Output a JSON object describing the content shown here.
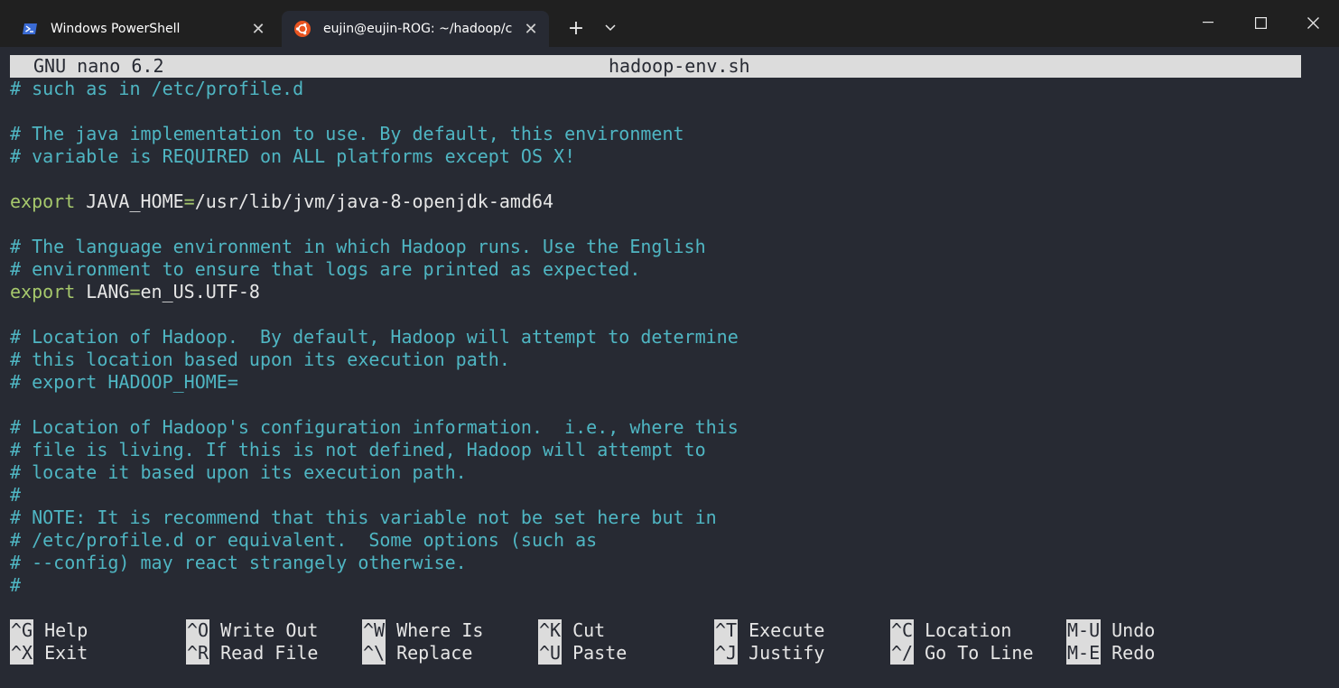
{
  "tabs": [
    {
      "label": "Windows PowerShell",
      "icon": "powershell-icon"
    },
    {
      "label": "eujin@eujin-ROG: ~/hadoop/c",
      "icon": "ubuntu-icon"
    }
  ],
  "colors": {
    "comment": "#4fb6c3",
    "keyword": "#a6c86c",
    "text": "#e6e6e6",
    "background": "#272a33",
    "header": "#dcdcdc"
  },
  "editor": {
    "name": "GNU nano 6.2",
    "filename": "hadoop-env.sh",
    "lines": [
      {
        "segments": [
          {
            "type": "comment",
            "text": "# such as in /etc/profile.d"
          }
        ]
      },
      {
        "segments": []
      },
      {
        "segments": [
          {
            "type": "comment",
            "text": "# The java implementation to use. By default, this environment"
          }
        ]
      },
      {
        "segments": [
          {
            "type": "comment",
            "text": "# variable is REQUIRED on ALL platforms except OS X!"
          }
        ]
      },
      {
        "segments": []
      },
      {
        "segments": [
          {
            "type": "kw",
            "text": "export"
          },
          {
            "type": "text",
            "text": " JAVA_HOME"
          },
          {
            "type": "op",
            "text": "="
          },
          {
            "type": "text",
            "text": "/usr/lib/jvm/java-8-openjdk-amd64"
          }
        ]
      },
      {
        "segments": []
      },
      {
        "segments": [
          {
            "type": "comment",
            "text": "# The language environment in which Hadoop runs. Use the English"
          }
        ]
      },
      {
        "segments": [
          {
            "type": "comment",
            "text": "# environment to ensure that logs are printed as expected."
          }
        ]
      },
      {
        "segments": [
          {
            "type": "kw",
            "text": "export"
          },
          {
            "type": "text",
            "text": " LANG"
          },
          {
            "type": "op",
            "text": "="
          },
          {
            "type": "text",
            "text": "en_US.UTF-8"
          }
        ]
      },
      {
        "segments": []
      },
      {
        "segments": [
          {
            "type": "comment",
            "text": "# Location of Hadoop.  By default, Hadoop will attempt to determine"
          }
        ]
      },
      {
        "segments": [
          {
            "type": "comment",
            "text": "# this location based upon its execution path."
          }
        ]
      },
      {
        "segments": [
          {
            "type": "comment",
            "text": "# export HADOOP_HOME="
          }
        ]
      },
      {
        "segments": []
      },
      {
        "segments": [
          {
            "type": "comment",
            "text": "# Location of Hadoop's configuration information.  i.e., where this"
          }
        ]
      },
      {
        "segments": [
          {
            "type": "comment",
            "text": "# file is living. If this is not defined, Hadoop will attempt to"
          }
        ]
      },
      {
        "segments": [
          {
            "type": "comment",
            "text": "# locate it based upon its execution path."
          }
        ]
      },
      {
        "segments": [
          {
            "type": "comment",
            "text": "#"
          }
        ]
      },
      {
        "segments": [
          {
            "type": "comment",
            "text": "# NOTE: It is recommend that this variable not be set here but in"
          }
        ]
      },
      {
        "segments": [
          {
            "type": "comment",
            "text": "# /etc/profile.d or equivalent.  Some options (such as"
          }
        ]
      },
      {
        "segments": [
          {
            "type": "comment",
            "text": "# --config) may react strangely otherwise."
          }
        ]
      },
      {
        "segments": [
          {
            "type": "comment",
            "text": "#"
          }
        ]
      }
    ]
  },
  "shortcuts": [
    {
      "key": "^G",
      "label": "Help"
    },
    {
      "key": "^X",
      "label": "Exit"
    },
    {
      "key": "^O",
      "label": "Write Out"
    },
    {
      "key": "^R",
      "label": "Read File"
    },
    {
      "key": "^W",
      "label": "Where Is"
    },
    {
      "key": "^\\",
      "label": "Replace"
    },
    {
      "key": "^K",
      "label": "Cut"
    },
    {
      "key": "^U",
      "label": "Paste"
    },
    {
      "key": "^T",
      "label": "Execute"
    },
    {
      "key": "^J",
      "label": "Justify"
    },
    {
      "key": "^C",
      "label": "Location"
    },
    {
      "key": "^/",
      "label": "Go To Line"
    },
    {
      "key": "M-U",
      "label": "Undo"
    },
    {
      "key": "M-E",
      "label": "Redo"
    }
  ]
}
